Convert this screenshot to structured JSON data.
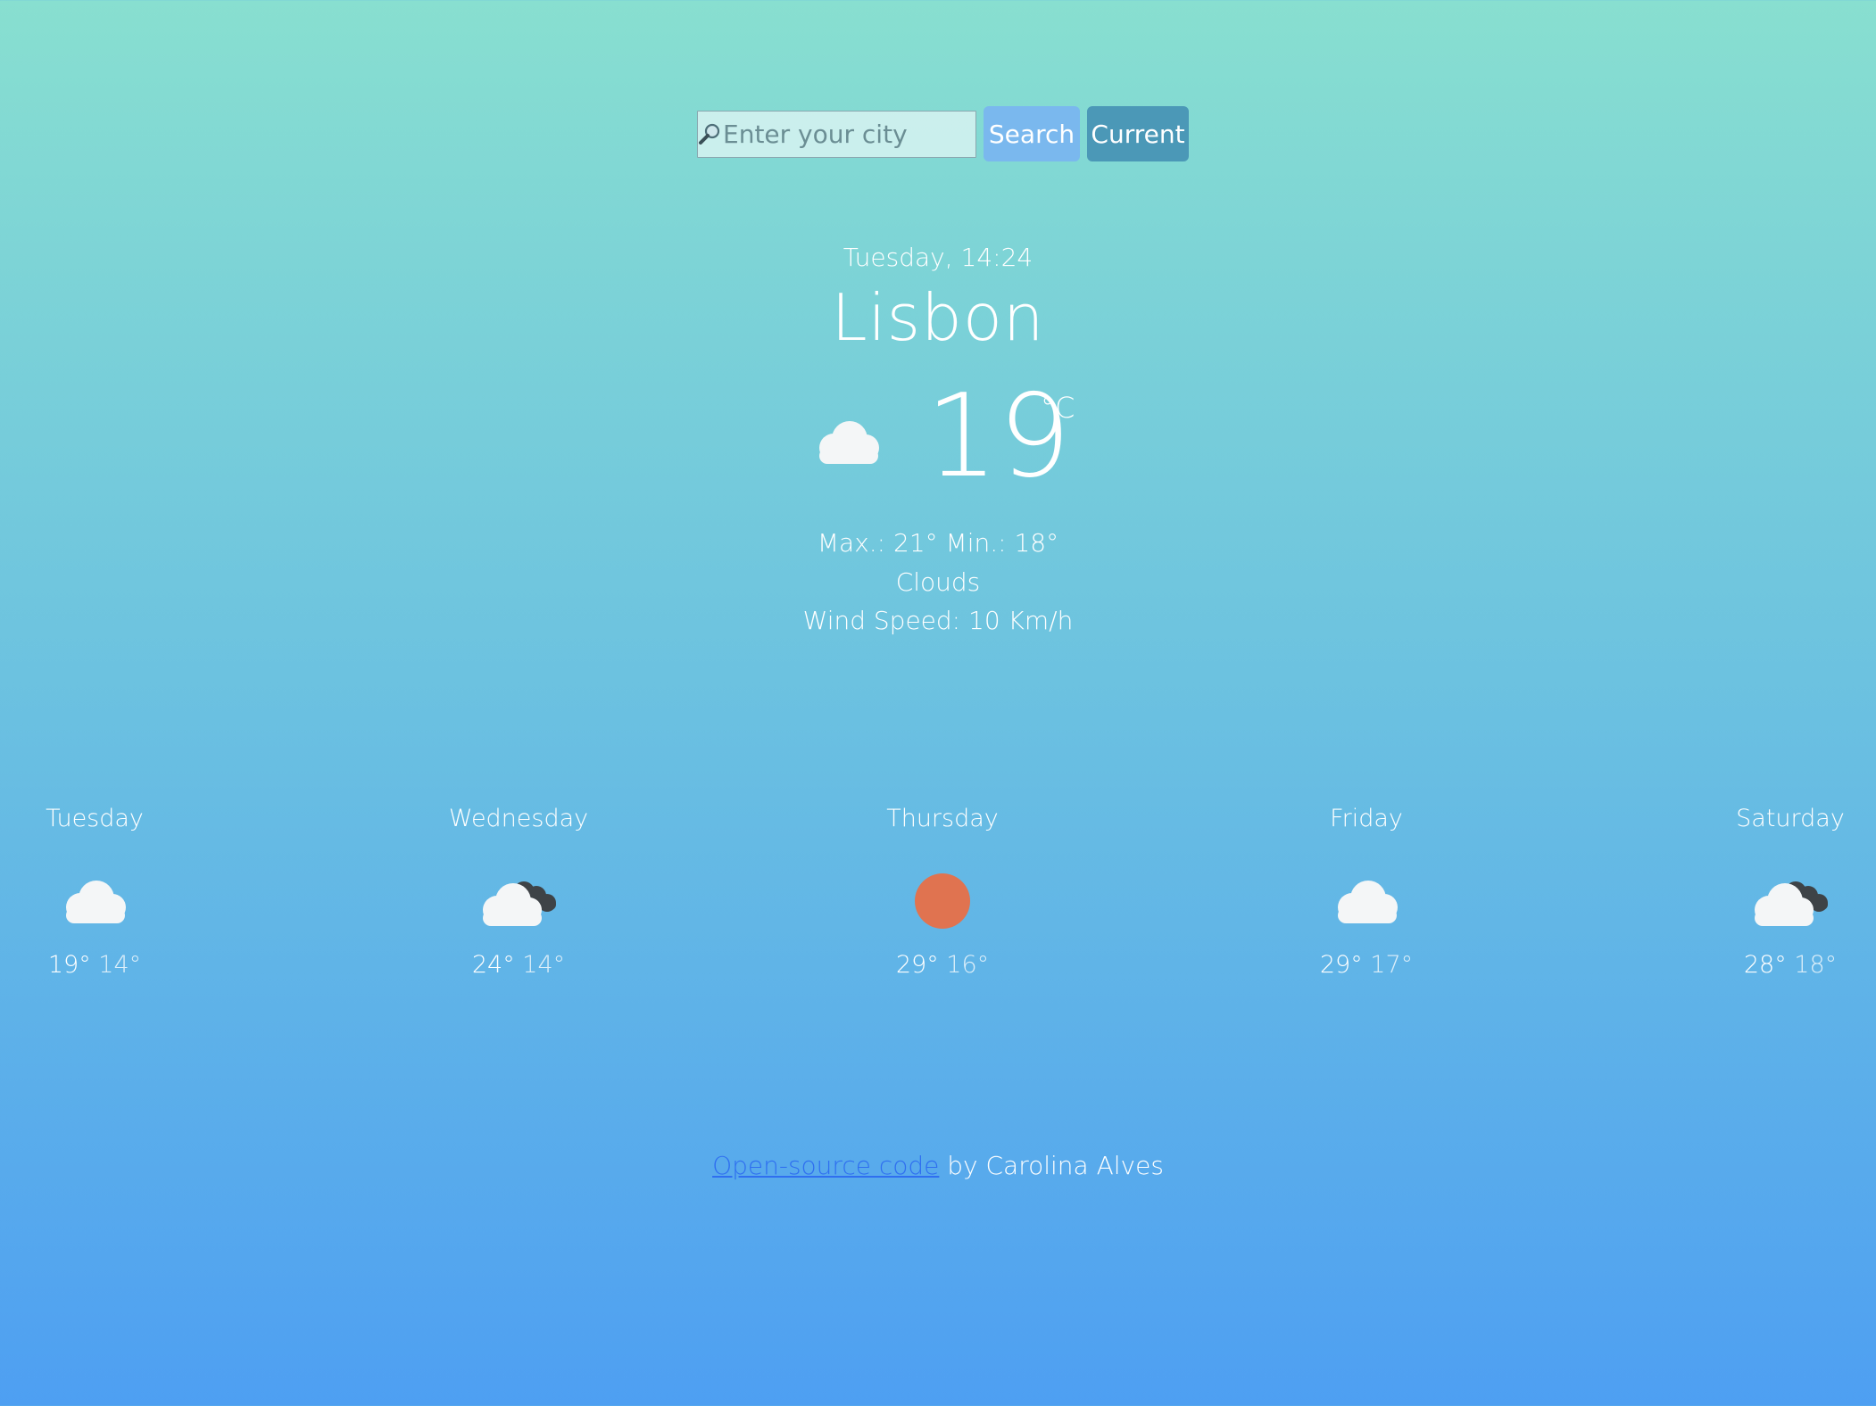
{
  "search": {
    "placeholder": "Enter your city",
    "search_label": "Search",
    "current_label": "Current",
    "icon": "magnifier-icon"
  },
  "current": {
    "datetime": "Tuesday, 14:24",
    "city": "Lisbon",
    "icon": "cloud-icon",
    "temperature": "19",
    "unit": "°C",
    "maxmin": "Max.: 21° Min.: 18°",
    "description": "Clouds",
    "wind": "Wind Speed: 10 Km/h"
  },
  "forecast": [
    {
      "day": "Tuesday",
      "icon": "cloud-icon",
      "max": "19°",
      "min": "14°"
    },
    {
      "day": "Wednesday",
      "icon": "cloud-dark-cloud-icon",
      "max": "24°",
      "min": "14°"
    },
    {
      "day": "Thursday",
      "icon": "sun-icon",
      "max": "29°",
      "min": "16°"
    },
    {
      "day": "Friday",
      "icon": "cloud-icon",
      "max": "29°",
      "min": "17°"
    },
    {
      "day": "Saturday",
      "icon": "cloud-dark-cloud-icon",
      "max": "28°",
      "min": "18°"
    }
  ],
  "footer": {
    "link_text": "Open-source code",
    "suffix": " by Carolina Alves"
  },
  "colors": {
    "search_button": "#7ab8ee",
    "current_button": "#4b98b7",
    "sun": "#e07350",
    "link": "#2f6ff0"
  }
}
